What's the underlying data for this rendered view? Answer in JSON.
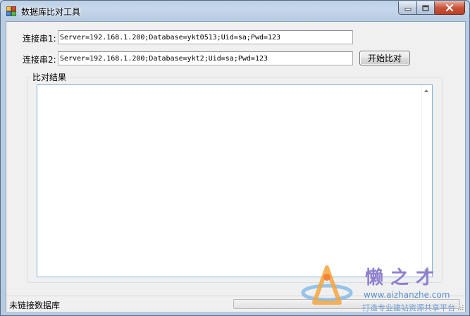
{
  "window": {
    "title": "数据库比对工具",
    "icons": {
      "app": "database-app-icon",
      "minimize": "minimize-icon",
      "maximize": "maximize-icon",
      "close": "close-icon"
    }
  },
  "form": {
    "conn1_label": "连接串1:",
    "conn1_value": "Server=192.168.1.200;Database=ykt0513;Uid=sa;Pwd=123",
    "conn2_label": "连接串2:",
    "conn2_value": "Server=192.168.1.200;Database=ykt2;Uid=sa;Pwd=123",
    "compare_button": "开始比对",
    "result_group": "比对结果",
    "result_text": ""
  },
  "status": {
    "text": "未链接数据库",
    "progress_percent": 0
  },
  "watermark": {
    "title": "懒之才",
    "url": "www.aizhanzhe.com",
    "slogan": "打造专业建站资源共享平台"
  },
  "colors": {
    "progress_fill": "#06b025",
    "close_button": "#c8553c"
  }
}
